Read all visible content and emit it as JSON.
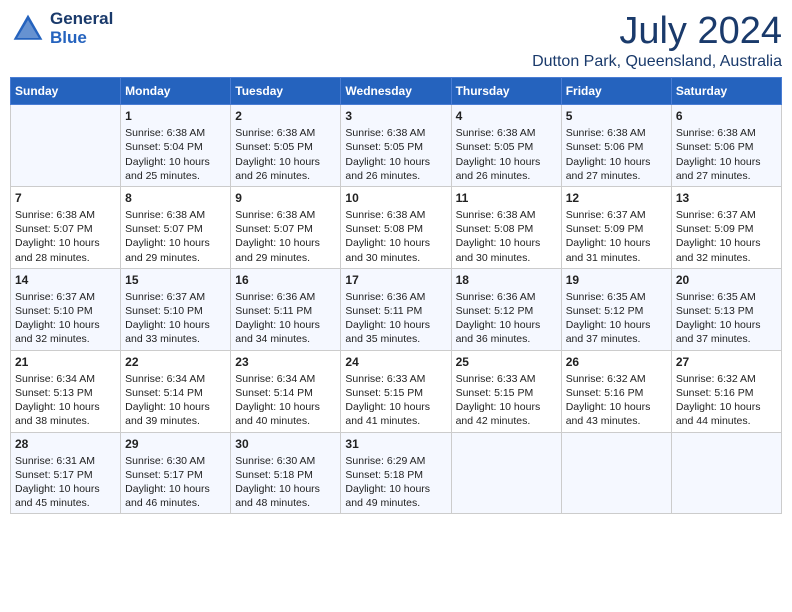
{
  "header": {
    "logo_line1": "General",
    "logo_line2": "Blue",
    "month": "July 2024",
    "location": "Dutton Park, Queensland, Australia"
  },
  "days_of_week": [
    "Sunday",
    "Monday",
    "Tuesday",
    "Wednesday",
    "Thursday",
    "Friday",
    "Saturday"
  ],
  "weeks": [
    [
      {
        "day": "",
        "info": ""
      },
      {
        "day": "1",
        "info": "Sunrise: 6:38 AM\nSunset: 5:04 PM\nDaylight: 10 hours\nand 25 minutes."
      },
      {
        "day": "2",
        "info": "Sunrise: 6:38 AM\nSunset: 5:05 PM\nDaylight: 10 hours\nand 26 minutes."
      },
      {
        "day": "3",
        "info": "Sunrise: 6:38 AM\nSunset: 5:05 PM\nDaylight: 10 hours\nand 26 minutes."
      },
      {
        "day": "4",
        "info": "Sunrise: 6:38 AM\nSunset: 5:05 PM\nDaylight: 10 hours\nand 26 minutes."
      },
      {
        "day": "5",
        "info": "Sunrise: 6:38 AM\nSunset: 5:06 PM\nDaylight: 10 hours\nand 27 minutes."
      },
      {
        "day": "6",
        "info": "Sunrise: 6:38 AM\nSunset: 5:06 PM\nDaylight: 10 hours\nand 27 minutes."
      }
    ],
    [
      {
        "day": "7",
        "info": "Sunrise: 6:38 AM\nSunset: 5:07 PM\nDaylight: 10 hours\nand 28 minutes."
      },
      {
        "day": "8",
        "info": "Sunrise: 6:38 AM\nSunset: 5:07 PM\nDaylight: 10 hours\nand 29 minutes."
      },
      {
        "day": "9",
        "info": "Sunrise: 6:38 AM\nSunset: 5:07 PM\nDaylight: 10 hours\nand 29 minutes."
      },
      {
        "day": "10",
        "info": "Sunrise: 6:38 AM\nSunset: 5:08 PM\nDaylight: 10 hours\nand 30 minutes."
      },
      {
        "day": "11",
        "info": "Sunrise: 6:38 AM\nSunset: 5:08 PM\nDaylight: 10 hours\nand 30 minutes."
      },
      {
        "day": "12",
        "info": "Sunrise: 6:37 AM\nSunset: 5:09 PM\nDaylight: 10 hours\nand 31 minutes."
      },
      {
        "day": "13",
        "info": "Sunrise: 6:37 AM\nSunset: 5:09 PM\nDaylight: 10 hours\nand 32 minutes."
      }
    ],
    [
      {
        "day": "14",
        "info": "Sunrise: 6:37 AM\nSunset: 5:10 PM\nDaylight: 10 hours\nand 32 minutes."
      },
      {
        "day": "15",
        "info": "Sunrise: 6:37 AM\nSunset: 5:10 PM\nDaylight: 10 hours\nand 33 minutes."
      },
      {
        "day": "16",
        "info": "Sunrise: 6:36 AM\nSunset: 5:11 PM\nDaylight: 10 hours\nand 34 minutes."
      },
      {
        "day": "17",
        "info": "Sunrise: 6:36 AM\nSunset: 5:11 PM\nDaylight: 10 hours\nand 35 minutes."
      },
      {
        "day": "18",
        "info": "Sunrise: 6:36 AM\nSunset: 5:12 PM\nDaylight: 10 hours\nand 36 minutes."
      },
      {
        "day": "19",
        "info": "Sunrise: 6:35 AM\nSunset: 5:12 PM\nDaylight: 10 hours\nand 37 minutes."
      },
      {
        "day": "20",
        "info": "Sunrise: 6:35 AM\nSunset: 5:13 PM\nDaylight: 10 hours\nand 37 minutes."
      }
    ],
    [
      {
        "day": "21",
        "info": "Sunrise: 6:34 AM\nSunset: 5:13 PM\nDaylight: 10 hours\nand 38 minutes."
      },
      {
        "day": "22",
        "info": "Sunrise: 6:34 AM\nSunset: 5:14 PM\nDaylight: 10 hours\nand 39 minutes."
      },
      {
        "day": "23",
        "info": "Sunrise: 6:34 AM\nSunset: 5:14 PM\nDaylight: 10 hours\nand 40 minutes."
      },
      {
        "day": "24",
        "info": "Sunrise: 6:33 AM\nSunset: 5:15 PM\nDaylight: 10 hours\nand 41 minutes."
      },
      {
        "day": "25",
        "info": "Sunrise: 6:33 AM\nSunset: 5:15 PM\nDaylight: 10 hours\nand 42 minutes."
      },
      {
        "day": "26",
        "info": "Sunrise: 6:32 AM\nSunset: 5:16 PM\nDaylight: 10 hours\nand 43 minutes."
      },
      {
        "day": "27",
        "info": "Sunrise: 6:32 AM\nSunset: 5:16 PM\nDaylight: 10 hours\nand 44 minutes."
      }
    ],
    [
      {
        "day": "28",
        "info": "Sunrise: 6:31 AM\nSunset: 5:17 PM\nDaylight: 10 hours\nand 45 minutes."
      },
      {
        "day": "29",
        "info": "Sunrise: 6:30 AM\nSunset: 5:17 PM\nDaylight: 10 hours\nand 46 minutes."
      },
      {
        "day": "30",
        "info": "Sunrise: 6:30 AM\nSunset: 5:18 PM\nDaylight: 10 hours\nand 48 minutes."
      },
      {
        "day": "31",
        "info": "Sunrise: 6:29 AM\nSunset: 5:18 PM\nDaylight: 10 hours\nand 49 minutes."
      },
      {
        "day": "",
        "info": ""
      },
      {
        "day": "",
        "info": ""
      },
      {
        "day": "",
        "info": ""
      }
    ]
  ]
}
